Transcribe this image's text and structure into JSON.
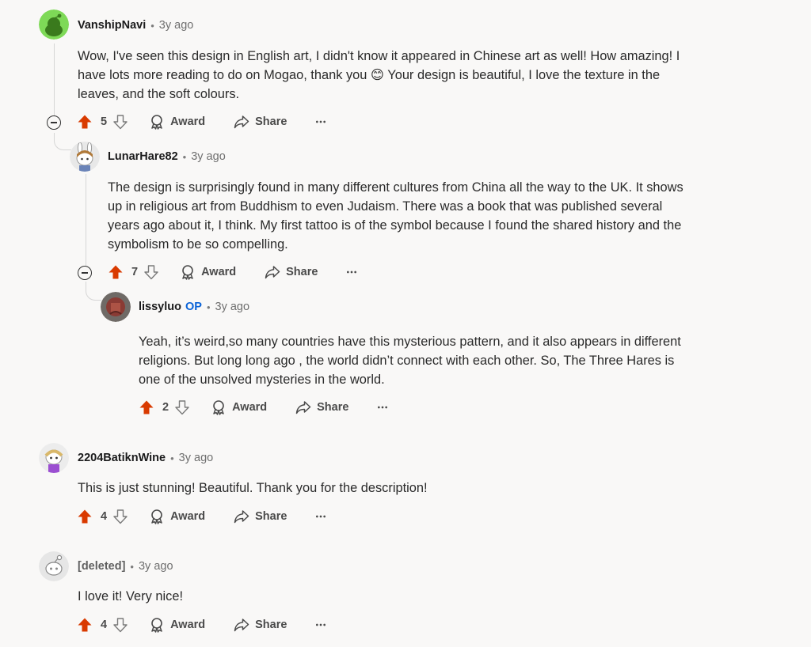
{
  "labels": {
    "award": "Award",
    "share": "Share",
    "op": "OP",
    "separator": "•"
  },
  "colors": {
    "upvote": "#d93a00",
    "op": "#0a63d8"
  },
  "comments": [
    {
      "username": "VanshipNavi",
      "time": "3y ago",
      "body": [
        "Wow, I've seen this design in English art, I didn't know it appeared in Chinese art as well! How amazing! I",
        "have lots more reading to do on Mogao, thank you 😊 Your design is beautiful, I love the texture in the",
        "leaves, and the soft colours."
      ],
      "score": "5",
      "avatar": "green-snoo-avatar"
    },
    {
      "username": "LunarHare82",
      "time": "3y ago",
      "body": [
        "The design is surprisingly found in many different cultures from China all the way to the UK. It shows",
        "up in religious art from Buddhism to even Judaism. There was a book that was published several",
        "years ago about it, I think. My first tattoo is of the symbol because I found the shared history and the",
        "symbolism to be so compelling."
      ],
      "score": "7",
      "avatar": "bunny-ears-snoo-avatar"
    },
    {
      "username": "lissyluo",
      "time": "3y ago",
      "body": [
        "Yeah, it’s weird,so many countries have this mysterious pattern, and it also appears in different",
        "religions. But long long ago , the world didn’t connect with each other. So, The Three Hares is",
        "one of the unsolved mysteries in the world."
      ],
      "score": "2",
      "avatar": "photo-avatar"
    },
    {
      "username": "2204BatiknWine",
      "time": "3y ago",
      "body": [
        "This is just stunning! Beautiful. Thank you for the description!"
      ],
      "score": "4",
      "avatar": "snoo-avatar"
    },
    {
      "username": "[deleted]",
      "time": "3y ago",
      "body": [
        "I love it! Very nice!"
      ],
      "score": "4",
      "avatar": "default-snoo-avatar"
    }
  ]
}
